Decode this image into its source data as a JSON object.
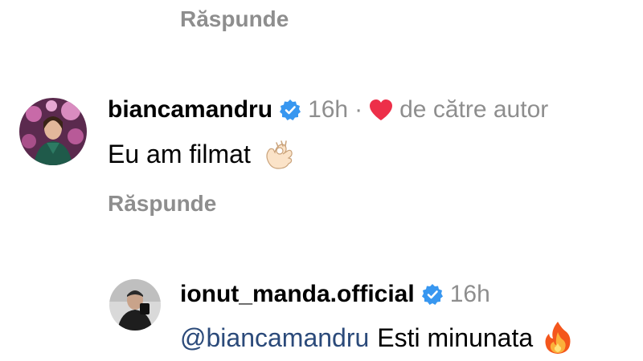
{
  "top_reply": {
    "label": "Răspunde"
  },
  "comment_1": {
    "username": "biancamandru",
    "time": "16h",
    "separator": "·",
    "liked_by": "de către autor",
    "text": "Eu am filmat",
    "emoji": "ok-hand-emoji",
    "reply_label": "Răspunde"
  },
  "comment_2": {
    "username": "ionut_manda.official",
    "time": "16h",
    "mention": "@biancamandru",
    "text": "Esti minunata",
    "emoji": "fire-emoji"
  },
  "colors": {
    "secondary_text": "#8e8e8e",
    "verified_blue": "#3897f0",
    "heart_red": "#ed2f49",
    "mention_blue": "#2b4a7a"
  },
  "icons": {
    "verified": "verified-badge-icon",
    "heart": "heart-icon"
  }
}
